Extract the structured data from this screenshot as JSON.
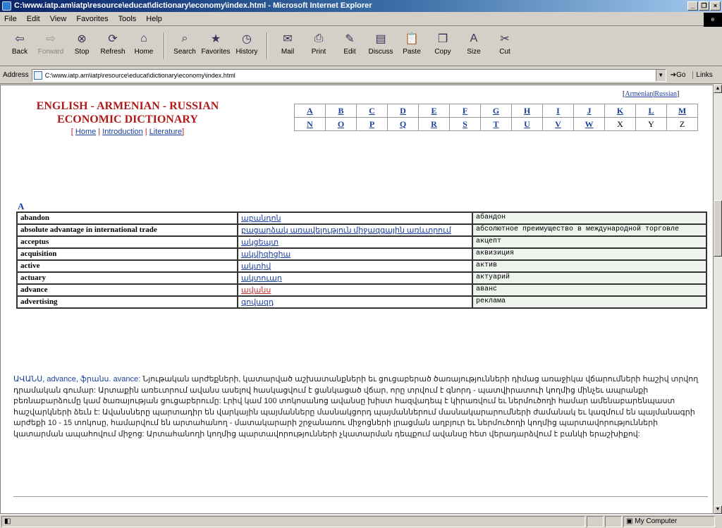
{
  "window": {
    "title": "C:\\www.iatp.am\\iatp\\resource\\educat\\dictionary\\economy\\index.html - Microsoft Internet Explorer"
  },
  "menu": [
    "File",
    "Edit",
    "View",
    "Favorites",
    "Tools",
    "Help"
  ],
  "toolbar": [
    {
      "label": "Back",
      "icon": "back-arrow-icon"
    },
    {
      "label": "Forward",
      "icon": "forward-arrow-icon",
      "disabled": true
    },
    {
      "label": "Stop",
      "icon": "stop-icon"
    },
    {
      "label": "Refresh",
      "icon": "refresh-icon"
    },
    {
      "label": "Home",
      "icon": "home-icon"
    },
    {
      "label": "Search",
      "icon": "search-icon"
    },
    {
      "label": "Favorites",
      "icon": "favorites-icon"
    },
    {
      "label": "History",
      "icon": "history-icon"
    },
    {
      "label": "Mail",
      "icon": "mail-icon"
    },
    {
      "label": "Print",
      "icon": "print-icon"
    },
    {
      "label": "Edit",
      "icon": "edit-icon"
    },
    {
      "label": "Discuss",
      "icon": "discuss-icon"
    },
    {
      "label": "Paste",
      "icon": "paste-icon"
    },
    {
      "label": "Copy",
      "icon": "copy-icon"
    },
    {
      "label": "Size",
      "icon": "size-icon"
    },
    {
      "label": "Cut",
      "icon": "cut-icon"
    }
  ],
  "address": {
    "label": "Address",
    "value": "C:\\www.iatp.am\\iatp\\resource\\educat\\dictionary\\economy\\index.html",
    "go": "Go",
    "links": "Links"
  },
  "page": {
    "lang_links": [
      "Armenian",
      "Russian"
    ],
    "title_line1": "ENGLISH - ARMENIAN - RUSSIAN",
    "title_line2": "ECONOMIC DICTIONARY",
    "nav": [
      "Home",
      "Introduction",
      "Literature"
    ],
    "letters_row1": [
      "A",
      "B",
      "C",
      "D",
      "E",
      "F",
      "G",
      "H",
      "I",
      "J",
      "K",
      "L",
      "M"
    ],
    "letters_row2": [
      "N",
      "O",
      "P",
      "Q",
      "R",
      "S",
      "T",
      "U",
      "V",
      "W",
      "X",
      "Y",
      "Z"
    ],
    "section": "A",
    "rows": [
      {
        "en": "abandon",
        "hy": "աբանդոն",
        "ru": "абандон"
      },
      {
        "en": "absolute advantage in international trade",
        "hy": "բացարձակ առավելություն միջազգային առևտրում",
        "ru": "абсолютное преимущество в международной торговле"
      },
      {
        "en": "acceptus",
        "hy": "ակցեպտ",
        "ru": "акцепт"
      },
      {
        "en": "acquisition",
        "hy": "ակվիզիցիա",
        "ru": "аквизиция"
      },
      {
        "en": "active",
        "hy": "ակտիվ",
        "ru": "актив"
      },
      {
        "en": "actuary",
        "hy": "ակտուար",
        "ru": "актуарий"
      },
      {
        "en": "advance",
        "hy": "ավանս",
        "ru": "аванс",
        "visited": true
      },
      {
        "en": "advertising",
        "hy": "գովազդ",
        "ru": "реклама"
      }
    ],
    "definition_head": "ԱՎԱՆՍ, advance, ֆրանս. avance:",
    "definition_body": " Նյութական արժեքների, կատարված աշխատանքների եւ ցուցաբերած ծառայությունների դիմաց առաջիկա վճարումների հաշիվ տրվող դրամական գումար: Արտաքին առեւտրում ավանս ասելով հասկացվում է ցանկացած վճար, որը տրվում է գնորդ - պատվիրատուի կողմից մինչեւ ապրանքի բեռնաբարձումը կամ ծառայության ցուցաբերումը: Լրիվ կամ 100 տոկոսանոց ավանսը խիստ հազվադեպ է կիրառվում եւ ներմուծողի համար ամենաբարենպաստ հաշվարկների ձեւն է: Ավանսները պարտադիր են վարկային պայմանները մասնակցորդ պայմաններում մասնակարարումների ժամանակ եւ կազմում են պայմանագրի արժեքի 10 - 15 տոկոսը, համարվում են արտահանող - մատակարարի շրջանառու միջոցների լրացման աղբյուր եւ ներմուծողի կողմից պարտավորությունների կատարման ապահովում միջոց: Արտահանողի կողմից պարտավորությունների չկատարման դեպքում ավանսը հետ վերադարձվում է բանկի երաշխիքով:"
  },
  "status": {
    "left": "",
    "zone": "My Computer"
  }
}
